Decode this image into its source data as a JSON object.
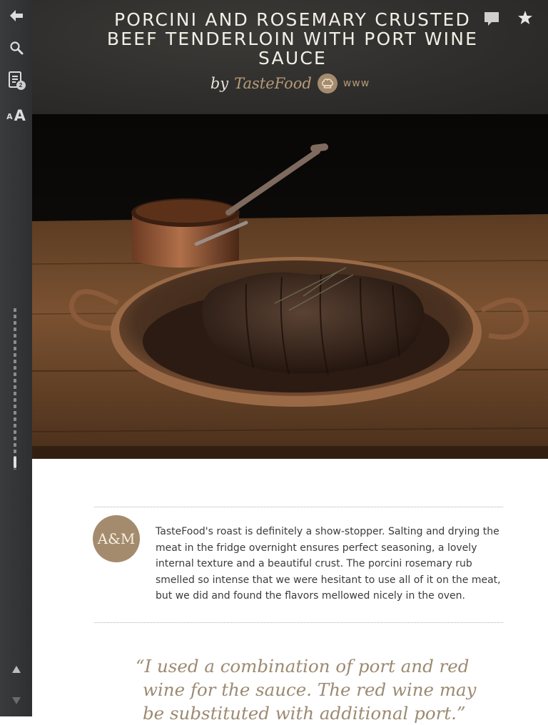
{
  "sidebar": {
    "back_icon": "left-arrow-icon",
    "search_icon": "search-icon",
    "list_icon": "notes-list-icon",
    "list_badge": "2",
    "font_small": "A",
    "font_large": "A",
    "scroll_up_icon": "triangle-up-icon",
    "scroll_down_icon": "triangle-down-icon"
  },
  "header": {
    "title": "PORCINI AND ROSEMARY CRUSTED BEEF TENDERLOIN WITH PORT WINE SAUCE",
    "by": "by",
    "author": "TasteFood",
    "www": "www",
    "comment_icon": "speech-bubble-icon",
    "star_icon": "star-icon"
  },
  "note": {
    "avatar": "A&M",
    "text": "TasteFood's roast is definitely a show-stopper. Salting and drying the meat in the fridge overnight ensures perfect seasoning, a lovely internal texture and a beautiful crust. The porcini rosemary rub smelled so intense that we were hesitant to use all of it on the meat, but we did and found the flavors mellowed nicely in the oven."
  },
  "quote": {
    "text": "“I used a combination of port and red wine for the sauce. The red wine may be substituted with additional port.”"
  },
  "colors": {
    "sidebar": "#333436",
    "header": "#2e2d2b",
    "accent": "#a58b6d",
    "quote": "#9c8a72"
  }
}
